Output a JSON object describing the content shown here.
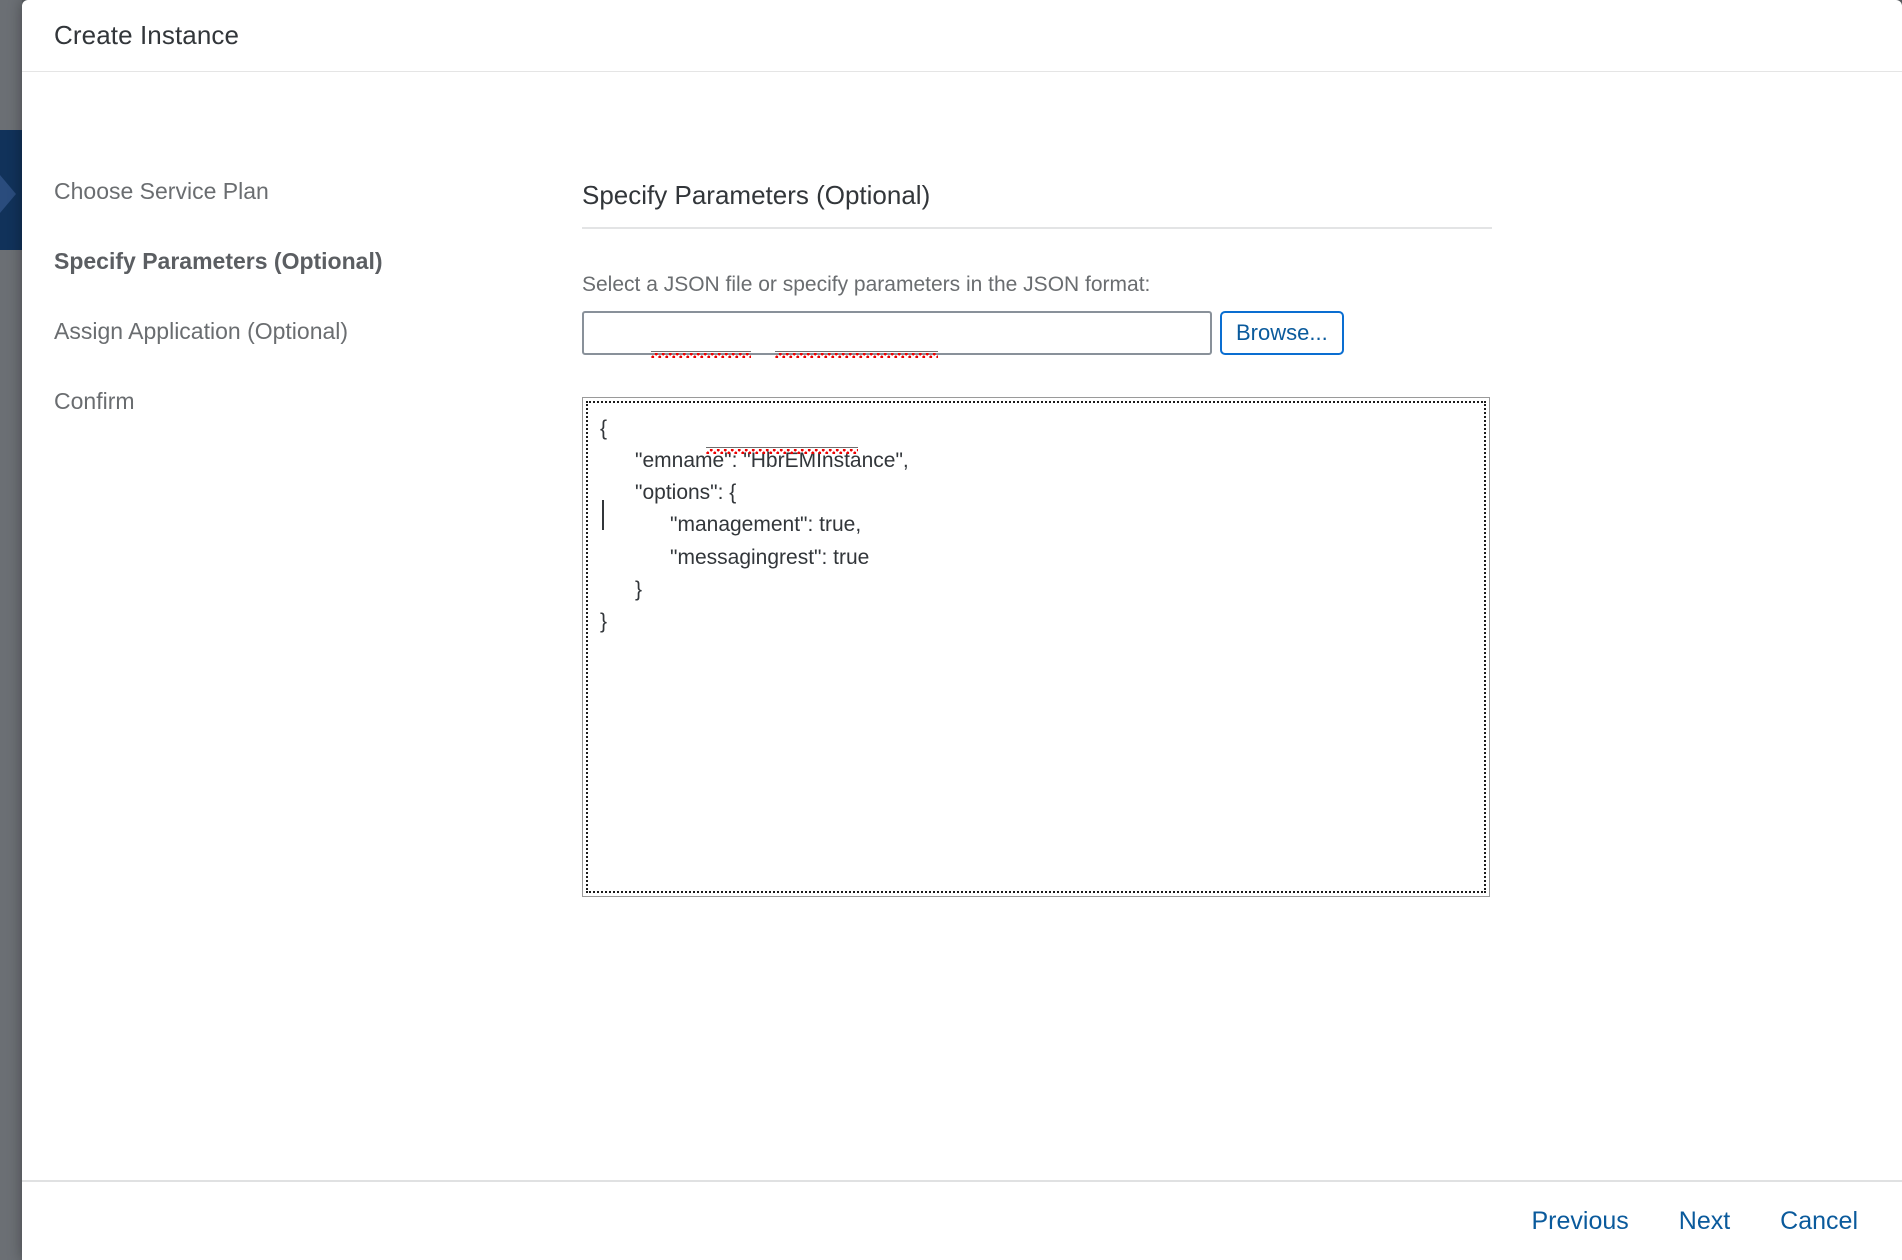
{
  "dialog": {
    "title": "Create Instance"
  },
  "steps": [
    {
      "label": "Choose Service Plan",
      "active": false
    },
    {
      "label": "Specify Parameters (Optional)",
      "active": true
    },
    {
      "label": "Assign Application (Optional)",
      "active": false
    },
    {
      "label": "Confirm",
      "active": false
    }
  ],
  "content": {
    "section_heading": "Specify Parameters (Optional)",
    "file_label": "Select a JSON file or specify parameters in the JSON format:",
    "file_input_value": "",
    "file_input_placeholder": "",
    "browse_label": "Browse...",
    "json_text": "{\n      \"emname\": \"HbrEMInstance\",\n      \"options\": {\n            \"management\": true,\n            \"messagingrest\": true\n      }\n}",
    "misspelled_words": [
      "emname",
      "HbrEMInstance",
      "messagingrest"
    ]
  },
  "footer": {
    "previous_label": "Previous",
    "next_label": "Next",
    "cancel_label": "Cancel"
  },
  "colors": {
    "accent_blue": "#0a6ed1",
    "link_blue": "#0a5a9c",
    "text_dark": "#32363a",
    "text_muted": "#6a6d70",
    "spellcheck_red": "#ee0000"
  }
}
